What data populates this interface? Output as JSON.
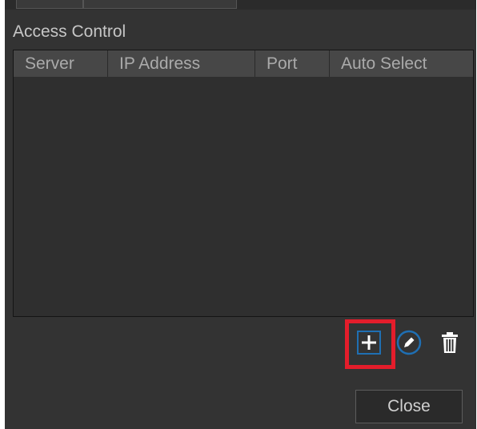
{
  "section": {
    "title": "Access Control"
  },
  "table": {
    "columns": [
      "Server",
      "IP Address",
      "Port",
      "Auto Select"
    ],
    "rows": []
  },
  "actions": {
    "add_icon": "plus-icon",
    "edit_icon": "pencil-circle-icon",
    "delete_icon": "trash-icon",
    "highlight_color": "#e41d2b",
    "accent_color": "#1f6fb3"
  },
  "footer": {
    "close_label": "Close"
  }
}
